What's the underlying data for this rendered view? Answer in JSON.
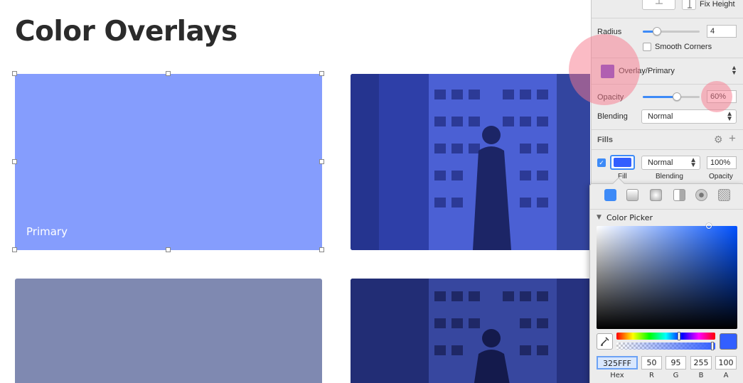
{
  "canvas": {
    "title": "Color Overlays",
    "primary_swatch": {
      "label": "Primary",
      "color": "#859dfd"
    },
    "secondary_swatch": {
      "color": "#7f89b1"
    },
    "photo_overlay_color": "#3a4fd0"
  },
  "inspector": {
    "fix_height_label": "Fix Height",
    "radius": {
      "label": "Radius",
      "value": "4"
    },
    "smooth_corners": {
      "label": "Smooth Corners",
      "checked": false
    },
    "style": {
      "name": "Overlay/Primary",
      "color": "#6a46d6"
    },
    "opacity": {
      "label": "Opacity",
      "value": "60%"
    },
    "blending": {
      "label": "Blending",
      "value": "Normal"
    },
    "fills": {
      "title": "Fills",
      "item": {
        "enabled": true,
        "color": "#325fff",
        "blending": "Normal",
        "opacity": "100%",
        "labels": {
          "fill": "Fill",
          "blending": "Blending",
          "opacity": "Opacity"
        }
      }
    }
  },
  "color_picker": {
    "section_title": "Color Picker",
    "hex": {
      "value": "325FFF",
      "label": "Hex"
    },
    "r": {
      "value": "50",
      "label": "R"
    },
    "g": {
      "value": "95",
      "label": "G"
    },
    "b": {
      "value": "255",
      "label": "B"
    },
    "a": {
      "value": "100",
      "label": "A"
    },
    "current_color": "#325fff",
    "hue_level": 0.63,
    "alpha_level": 1.0,
    "fill_types": [
      "solid-fill-icon",
      "linear-gradient-icon",
      "radial-gradient-icon",
      "angular-gradient-icon",
      "pattern-fill-icon",
      "noise-fill-icon"
    ]
  },
  "colors": {
    "accent": "#3d8af7",
    "highlight": "#f7788c"
  }
}
